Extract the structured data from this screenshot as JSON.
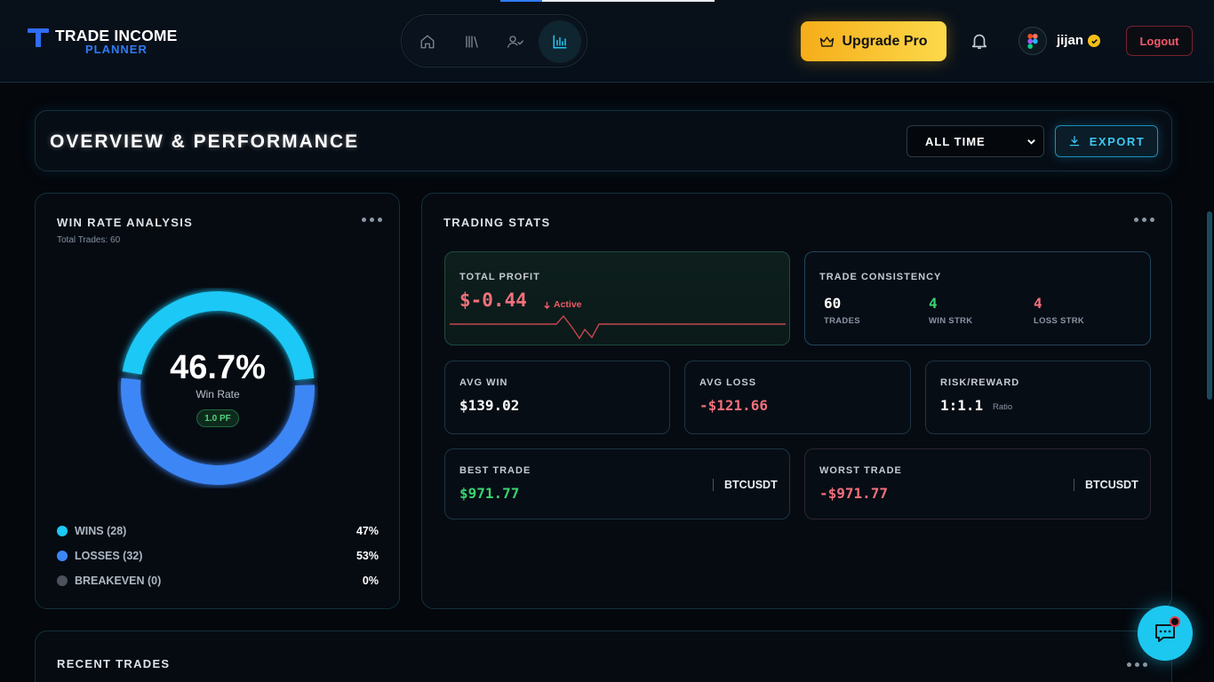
{
  "header": {
    "logo_line1": "TRADE INCOME",
    "logo_line2": "PLANNER",
    "nav": [
      {
        "name": "home-icon",
        "active": false
      },
      {
        "name": "library-icon",
        "active": false
      },
      {
        "name": "user-check-icon",
        "active": false
      },
      {
        "name": "bar-chart-icon",
        "active": true
      }
    ],
    "upgrade_label": "Upgrade Pro",
    "username": "jijan",
    "logout_label": "Logout"
  },
  "overview": {
    "title": "OVERVIEW & PERFORMANCE",
    "range_selected": "ALL TIME",
    "export_label": "EXPORT"
  },
  "win_rate": {
    "title": "WIN RATE ANALYSIS",
    "total_trades_label": "Total Trades: 60",
    "percent": "46.7%",
    "percent_value": 46.7,
    "sub_label": "Win Rate",
    "pf_badge": "1.0 PF",
    "legend": [
      {
        "label": "WINS (28)",
        "value": "47%",
        "color": "#1cc8f5"
      },
      {
        "label": "LOSSES (32)",
        "value": "53%",
        "color": "#3d86f5"
      },
      {
        "label": "BREAKEVEN (0)",
        "value": "0%",
        "color": "#4b525c"
      }
    ]
  },
  "stats": {
    "title": "TRADING STATS",
    "total_profit": {
      "label": "TOTAL PROFIT",
      "value": "$-0.44",
      "status": "Active"
    },
    "consistency": {
      "label": "TRADE CONSISTENCY",
      "items": [
        {
          "value": "60",
          "label": "TRADES"
        },
        {
          "value": "4",
          "label": "WIN STRK"
        },
        {
          "value": "4",
          "label": "LOSS STRK"
        }
      ]
    },
    "avg_win": {
      "label": "AVG WIN",
      "value": "$139.02"
    },
    "avg_loss": {
      "label": "AVG LOSS",
      "value": "-$121.66"
    },
    "risk_reward": {
      "label": "RISK/REWARD",
      "value": "1:1.1",
      "unit": "Ratio"
    },
    "best_trade": {
      "label": "BEST TRADE",
      "value": "$971.77",
      "pair": "BTCUSDT"
    },
    "worst_trade": {
      "label": "WORST TRADE",
      "value": "-$971.77",
      "pair": "BTCUSDT"
    }
  },
  "recent": {
    "title": "RECENT TRADES"
  },
  "colors": {
    "accent": "#1cc8f5",
    "positive": "#38d36f",
    "negative": "#f0707c",
    "gold": "#f6ad1a"
  }
}
